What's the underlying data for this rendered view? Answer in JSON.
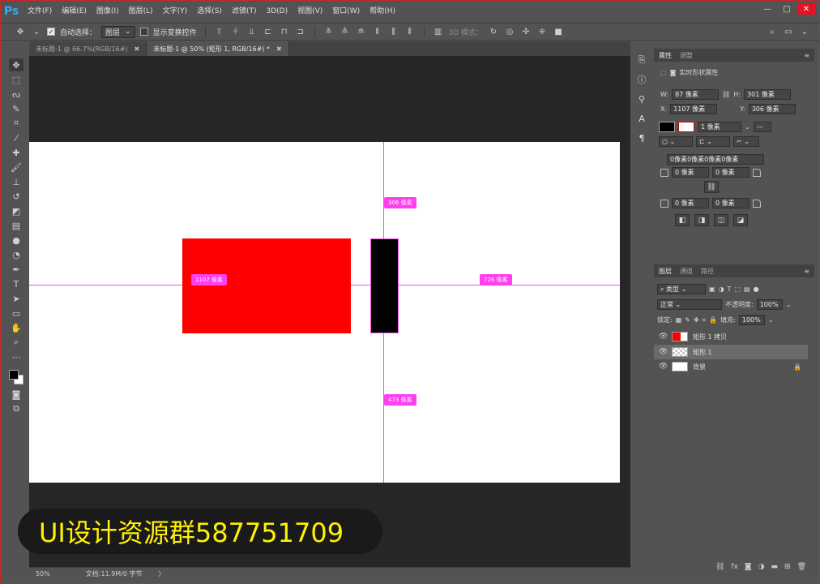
{
  "app": {
    "logo": "Ps"
  },
  "menu": [
    "文件(F)",
    "编辑(E)",
    "图像(I)",
    "图层(L)",
    "文字(Y)",
    "选择(S)",
    "滤镜(T)",
    "3D(D)",
    "视图(V)",
    "窗口(W)",
    "帮助(H)"
  ],
  "window_controls": {
    "minimize": "—",
    "restore": "□",
    "close": "✕"
  },
  "options": {
    "auto_select_label": "自动选择：",
    "auto_select_value": "图层",
    "show_transform_label": "显示变换控件",
    "mode_3d_label": "3D 模式："
  },
  "tabs": [
    {
      "label": "未标题-1 @ 66.7%(RGB/16#)",
      "close": "✖"
    },
    {
      "label": "未标题-1 @ 50% (矩形 1, RGB/16#) *",
      "close": "✖"
    }
  ],
  "tools": [
    "move-tool",
    "marquee-tool",
    "lasso-tool",
    "quick-select-tool",
    "crop-tool",
    "eyedropper-tool",
    "healing-tool",
    "brush-tool",
    "stamp-tool",
    "history-brush-tool",
    "eraser-tool",
    "gradient-tool",
    "blur-tool",
    "dodge-tool",
    "pen-tool",
    "type-tool",
    "path-select-tool",
    "rectangle-tool",
    "hand-tool",
    "zoom-tool",
    "more-tools"
  ],
  "measurements": {
    "top": "306 像素",
    "left": "1107 像素",
    "right": "726 像素",
    "bottom": "473 像素"
  },
  "watermark": "UI设计资源群587751709",
  "status": {
    "zoom": "50%",
    "doc": "文档:11.9M/0 字节",
    "arrow": "〉"
  },
  "properties": {
    "tabs": [
      "属性",
      "调整"
    ],
    "title": "实时形状属性",
    "w_label": "W:",
    "w": "87 像素",
    "h_label": "H:",
    "h": "301 像素",
    "x_label": "X:",
    "x": "1107 像素",
    "y_label": "Y:",
    "y": "306 像素",
    "stroke_width": "1 像素",
    "corners_all": "0像素0像素0像素0像素",
    "corner_tl": "0 像素",
    "corner_tr": "0 像素",
    "corner_bl": "0 像素",
    "corner_br": "0 像素"
  },
  "layers": {
    "tabs": [
      "图层",
      "通道",
      "路径"
    ],
    "filter_label": "类型",
    "blend_mode": "正常",
    "opacity_label": "不透明度:",
    "opacity": "100%",
    "lock_label": "锁定:",
    "fill_label": "填充:",
    "fill": "100%",
    "items": [
      {
        "name": "矩形 1 拷贝",
        "selected": false
      },
      {
        "name": "矩形 1",
        "selected": true
      },
      {
        "name": "背景",
        "selected": false
      }
    ]
  },
  "colors": {
    "accent": "#ff3ef0",
    "red_rect": "#ff0000",
    "watermark_text": "#fff200"
  }
}
